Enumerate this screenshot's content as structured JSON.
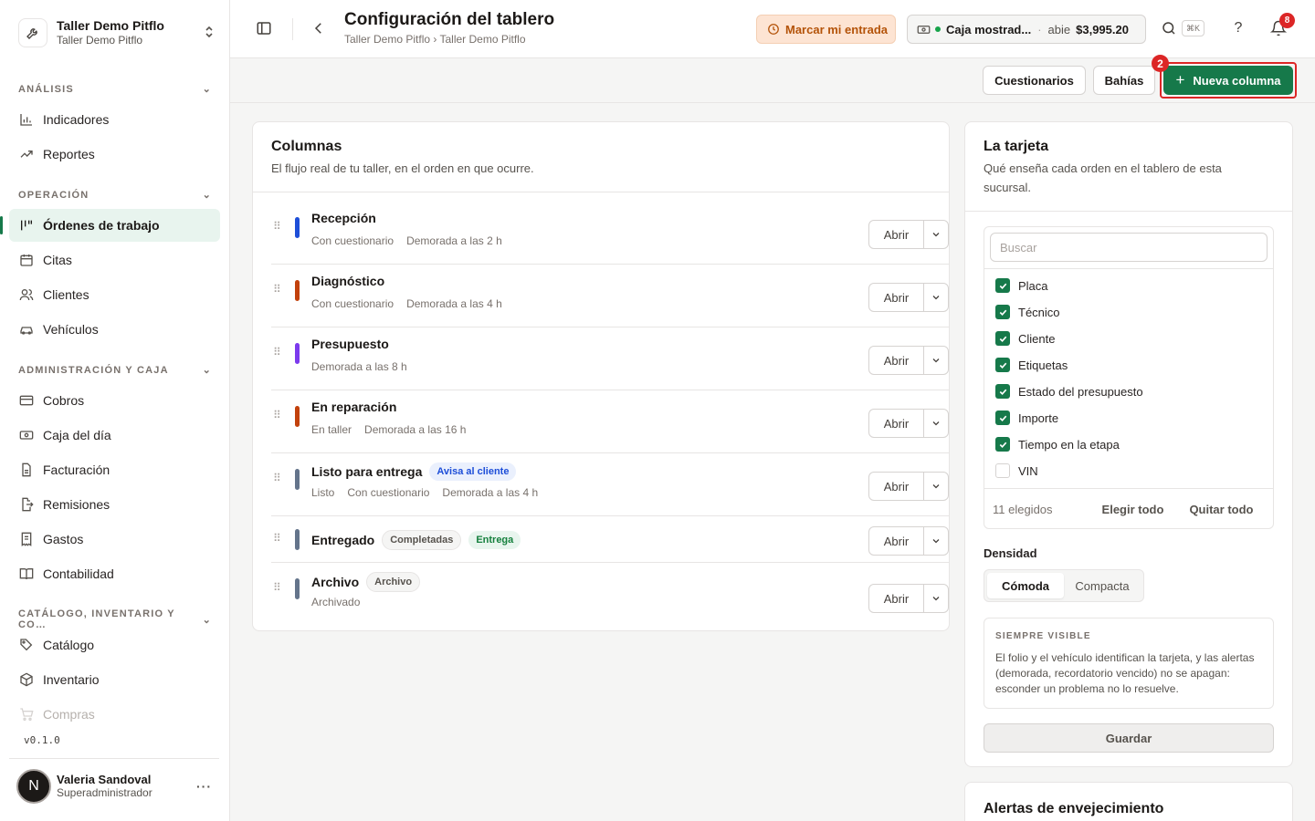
{
  "sidebar": {
    "org_name": "Taller Demo Pitflo",
    "org_sub": "Taller Demo Pitflo",
    "sections": [
      {
        "label": "ANÁLISIS",
        "items": [
          {
            "label": "Indicadores"
          },
          {
            "label": "Reportes"
          }
        ]
      },
      {
        "label": "OPERACIÓN",
        "items": [
          {
            "label": "Órdenes de trabajo"
          },
          {
            "label": "Citas"
          },
          {
            "label": "Clientes"
          },
          {
            "label": "Vehículos"
          }
        ]
      },
      {
        "label": "ADMINISTRACIÓN Y CAJA",
        "items": [
          {
            "label": "Cobros"
          },
          {
            "label": "Caja del día"
          },
          {
            "label": "Facturación"
          },
          {
            "label": "Remisiones"
          },
          {
            "label": "Gastos"
          },
          {
            "label": "Contabilidad"
          }
        ]
      },
      {
        "label": "CATÁLOGO, INVENTARIO Y CO…",
        "items": [
          {
            "label": "Catálogo"
          },
          {
            "label": "Inventario"
          },
          {
            "label": "Compras"
          }
        ]
      }
    ],
    "version": "v0.1.0",
    "user": {
      "initial": "N",
      "name": "Valeria Sandoval",
      "role": "Superadministrador"
    }
  },
  "header": {
    "title": "Configuración del tablero",
    "breadcrumb": "Taller Demo Pitflo › Taller Demo Pitflo",
    "clock_in": "Marcar mi entrada",
    "register": {
      "name": "Caja mostrad...",
      "status": "abie",
      "amount": "$3,995.20"
    },
    "shortcut": "⌘K",
    "help": "?",
    "notifications": "8"
  },
  "actions": {
    "questionnaires": "Cuestionarios",
    "bays": "Bahías",
    "new_column": "Nueva columna",
    "step_badge": "2"
  },
  "columns_card": {
    "title": "Columnas",
    "subtitle": "El flujo real de tu taller, en el orden en que ocurre.",
    "open_label": "Abrir",
    "rows": [
      {
        "name": "Recepción",
        "color": "#1d4ed8",
        "meta": [
          "Con cuestionario",
          "Demorada a las 2 h"
        ]
      },
      {
        "name": "Diagnóstico",
        "color": "#c2410c",
        "meta": [
          "Con cuestionario",
          "Demorada a las 4 h"
        ]
      },
      {
        "name": "Presupuesto",
        "color": "#7c3aed",
        "meta": [
          "Demorada a las 8 h"
        ]
      },
      {
        "name": "En reparación",
        "color": "#c2410c",
        "meta": [
          "En taller",
          "Demorada a las 16 h"
        ]
      },
      {
        "name": "Listo para entrega",
        "color": "#64748b",
        "chips": [
          {
            "text": "Avisa al cliente",
            "kind": "blue"
          }
        ],
        "meta": [
          "Listo",
          "Con cuestionario",
          "Demorada a las 4 h"
        ]
      },
      {
        "name": "Entregado",
        "color": "#64748b",
        "chips": [
          {
            "text": "Completadas",
            "kind": "gray"
          },
          {
            "text": "Entrega",
            "kind": "green"
          }
        ],
        "meta": []
      },
      {
        "name": "Archivo",
        "color": "#64748b",
        "chips": [
          {
            "text": "Archivo",
            "kind": "gray"
          }
        ],
        "meta": [
          "Archivado"
        ]
      }
    ]
  },
  "card_panel": {
    "title": "La tarjeta",
    "subtitle": "Qué enseña cada orden en el tablero de esta sucursal.",
    "search_placeholder": "Buscar",
    "fields": [
      {
        "label": "Placa",
        "checked": true
      },
      {
        "label": "Técnico",
        "checked": true
      },
      {
        "label": "Cliente",
        "checked": true
      },
      {
        "label": "Etiquetas",
        "checked": true
      },
      {
        "label": "Estado del presupuesto",
        "checked": true
      },
      {
        "label": "Importe",
        "checked": true
      },
      {
        "label": "Tiempo en la etapa",
        "checked": true
      },
      {
        "label": "VIN",
        "checked": false
      }
    ],
    "selected_count": "11 elegidos",
    "select_all": "Elegir todo",
    "clear_all": "Quitar todo",
    "density_label": "Densidad",
    "density_options": [
      "Cómoda",
      "Compacta"
    ],
    "density_selected": "Cómoda",
    "always_visible_title": "SIEMPRE VISIBLE",
    "always_visible_text": "El folio y el vehículo identifican la tarjeta, y las alertas (demorada, recordatorio vencido) no se apagan: esconder un problema no lo resuelve.",
    "save": "Guardar"
  },
  "aging_card": {
    "title": "Alertas de envejecimiento"
  },
  "colors": {
    "accent": "#16794a",
    "alert": "#dc2626",
    "warning_bg": "#fde4d3"
  }
}
